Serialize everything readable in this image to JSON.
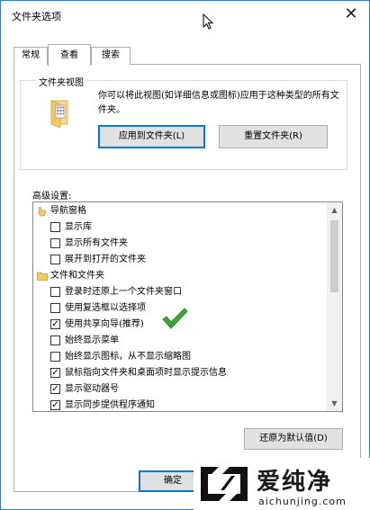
{
  "window": {
    "title": "文件夹选项",
    "close_glyph": "✕"
  },
  "tabs": [
    {
      "label": "常规"
    },
    {
      "label": "查看"
    },
    {
      "label": "搜索"
    }
  ],
  "folder_view": {
    "legend": "文件夹视图",
    "description": "你可以将此视图(如详细信息或图标)应用于这种类型的所有文件夹。",
    "apply_button": "应用到文件夹(L)",
    "reset_button": "重置文件夹(R)"
  },
  "advanced": {
    "label": "高级设置:",
    "items": [
      {
        "type": "group",
        "text": "导航窗格"
      },
      {
        "type": "checkbox",
        "text": "显示库",
        "checked": false
      },
      {
        "type": "checkbox",
        "text": "显示所有文件夹",
        "checked": false
      },
      {
        "type": "checkbox",
        "text": "展开到打开的文件夹",
        "checked": false
      },
      {
        "type": "group",
        "text": "文件和文件夹"
      },
      {
        "type": "checkbox",
        "text": "登录时还原上一个文件夹窗口",
        "checked": false
      },
      {
        "type": "checkbox",
        "text": "使用复选框以选择项",
        "checked": false
      },
      {
        "type": "checkbox",
        "text": "使用共享向导(推荐)",
        "checked": true
      },
      {
        "type": "checkbox",
        "text": "始终显示菜单",
        "checked": false
      },
      {
        "type": "checkbox",
        "text": "始终显示图标，从不显示缩略图",
        "checked": false
      },
      {
        "type": "checkbox",
        "text": "鼠标指向文件夹和桌面项时显示提示信息",
        "checked": true
      },
      {
        "type": "checkbox",
        "text": "显示驱动器号",
        "checked": true
      },
      {
        "type": "checkbox",
        "text": "显示同步提供程序通知",
        "checked": true
      }
    ],
    "check_glyph": "✓",
    "restore_button": "还原为默认值(D)"
  },
  "footer": {
    "ok_button": "确定"
  },
  "watermark": {
    "name": "爱纯净",
    "url": "aichunjing.com"
  },
  "colors": {
    "accent": "#0078d7",
    "check_green": "#3aa63a"
  }
}
